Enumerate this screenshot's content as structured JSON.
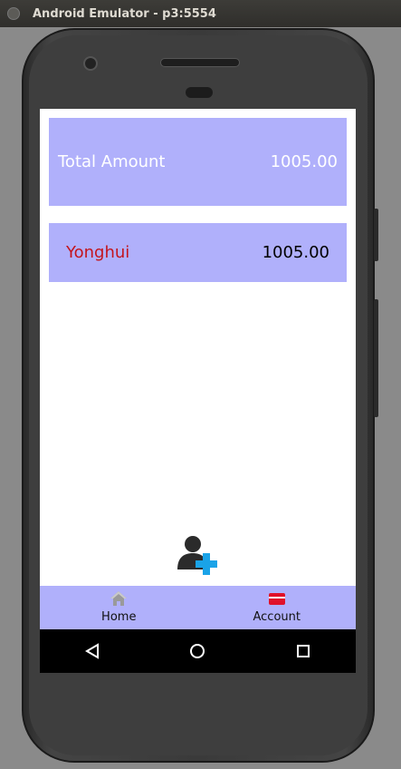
{
  "window": {
    "title": "Android Emulator - p3:5554"
  },
  "summary": {
    "label": "Total Amount",
    "amount": "1005.00"
  },
  "entries": [
    {
      "name": "Yonghui",
      "amount": "1005.00"
    }
  ],
  "fab": {
    "icon": "add-user-icon"
  },
  "bottom_nav": {
    "items": [
      {
        "label": "Home",
        "icon": "home-icon"
      },
      {
        "label": "Account",
        "icon": "wallet-icon",
        "icon_color": "#e0102a"
      }
    ]
  },
  "system_nav": {
    "icons": [
      "back-icon",
      "home-circle-icon",
      "recents-icon"
    ]
  },
  "colors": {
    "card_bg": "#b0b0fb",
    "entry_name": "#c4141c",
    "fab_plus": "#1aa3e8"
  }
}
